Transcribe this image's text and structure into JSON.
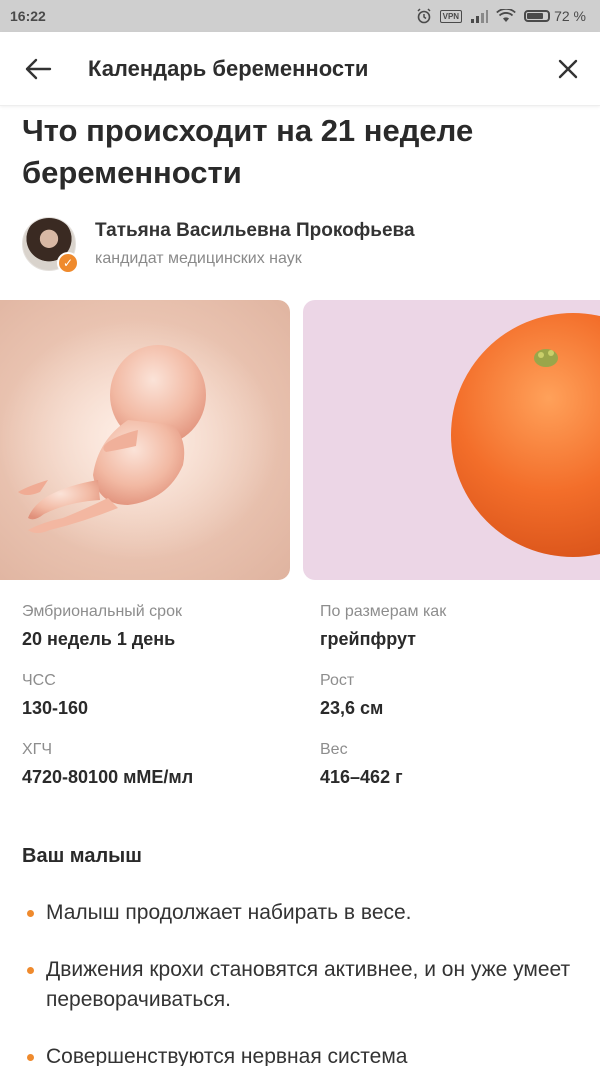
{
  "status_bar": {
    "time": "16:22",
    "vpn_label": "VPN",
    "battery": "72 %"
  },
  "app_bar": {
    "title": "Календарь беременности"
  },
  "page": {
    "title": "Что происходит на 21 неделе беременности"
  },
  "author": {
    "name": "Татьяна Васильевна Прокофьева",
    "role": "кандидат медицинских наук"
  },
  "stats": [
    {
      "label": "Эмбриональный срок",
      "value": "20 недель 1 день"
    },
    {
      "label": "По размерам как",
      "value": "грейпфрут"
    },
    {
      "label": "ЧСС",
      "value": "130-160"
    },
    {
      "label": "Рост",
      "value": "23,6 см"
    },
    {
      "label": "ХГЧ",
      "value": "4720-80100 мМЕ/мл"
    },
    {
      "label": "Вес",
      "value": "416–462 г"
    }
  ],
  "section": {
    "title": "Ваш малыш",
    "items": [
      "Малыш продолжает набирать в весе.",
      "Движения крохи становятся активнее, и он уже умеет переворачиваться.",
      "Совершенствуются нервная система"
    ]
  },
  "colors": {
    "accent": "#ef8a2d",
    "fruit_card_bg": "#ecd6e6"
  }
}
